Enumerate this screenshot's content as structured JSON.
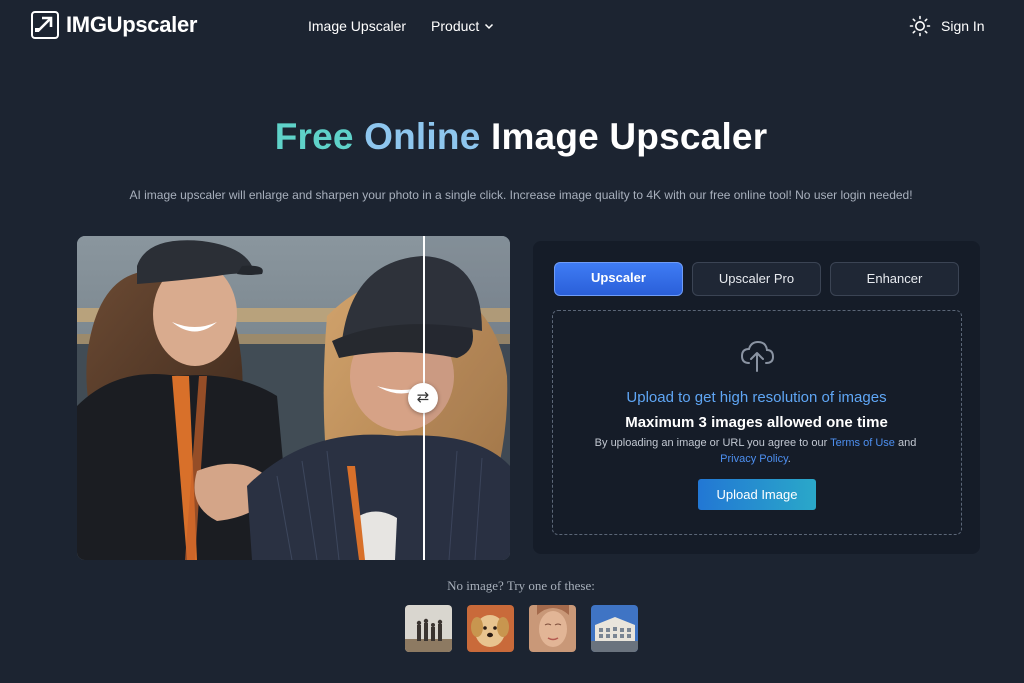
{
  "header": {
    "brand": "IMGUpscaler",
    "nav": [
      {
        "label": "Image Upscaler"
      },
      {
        "label": "Product",
        "icon": "chevron-down-icon"
      }
    ],
    "theme_icon": "sun-icon",
    "signin_label": "Sign In"
  },
  "hero": {
    "title_part1": "Free",
    "title_part2": "Online",
    "title_part3": "Image Upscaler",
    "subtitle": "AI image upscaler will enlarge and sharpen your photo in a single click. Increase image quality to 4K with our free online tool! No user login needed!"
  },
  "compare": {
    "handle_icon": "swap-arrows-icon",
    "divider_position": 0.8
  },
  "panel": {
    "tabs": [
      {
        "label": "Upscaler",
        "active": true
      },
      {
        "label": "Upscaler Pro",
        "active": false
      },
      {
        "label": "Enhancer",
        "active": false
      }
    ],
    "upload_icon": "cloud-upload-icon",
    "title": "Upload to get high resolution of images",
    "limit_text": "Maximum 3 images allowed one time",
    "terms_prefix": "By uploading an image or URL you agree to our",
    "terms_link": "Terms of Use",
    "terms_and": "and",
    "privacy_link": "Privacy Policy",
    "terms_suffix": ".",
    "upload_button": "Upload Image"
  },
  "samples": {
    "label": "No image? Try one of these:",
    "items": [
      {
        "name": "sample-family-beach"
      },
      {
        "name": "sample-puppy"
      },
      {
        "name": "sample-woman-face"
      },
      {
        "name": "sample-building"
      }
    ]
  },
  "colors": {
    "background": "#1c2431",
    "panel": "#151c28",
    "accent": "#3f7cf4",
    "title_teal": "#5fd2c9",
    "title_blue": "#8ec6ee",
    "link": "#4d8ff0"
  }
}
